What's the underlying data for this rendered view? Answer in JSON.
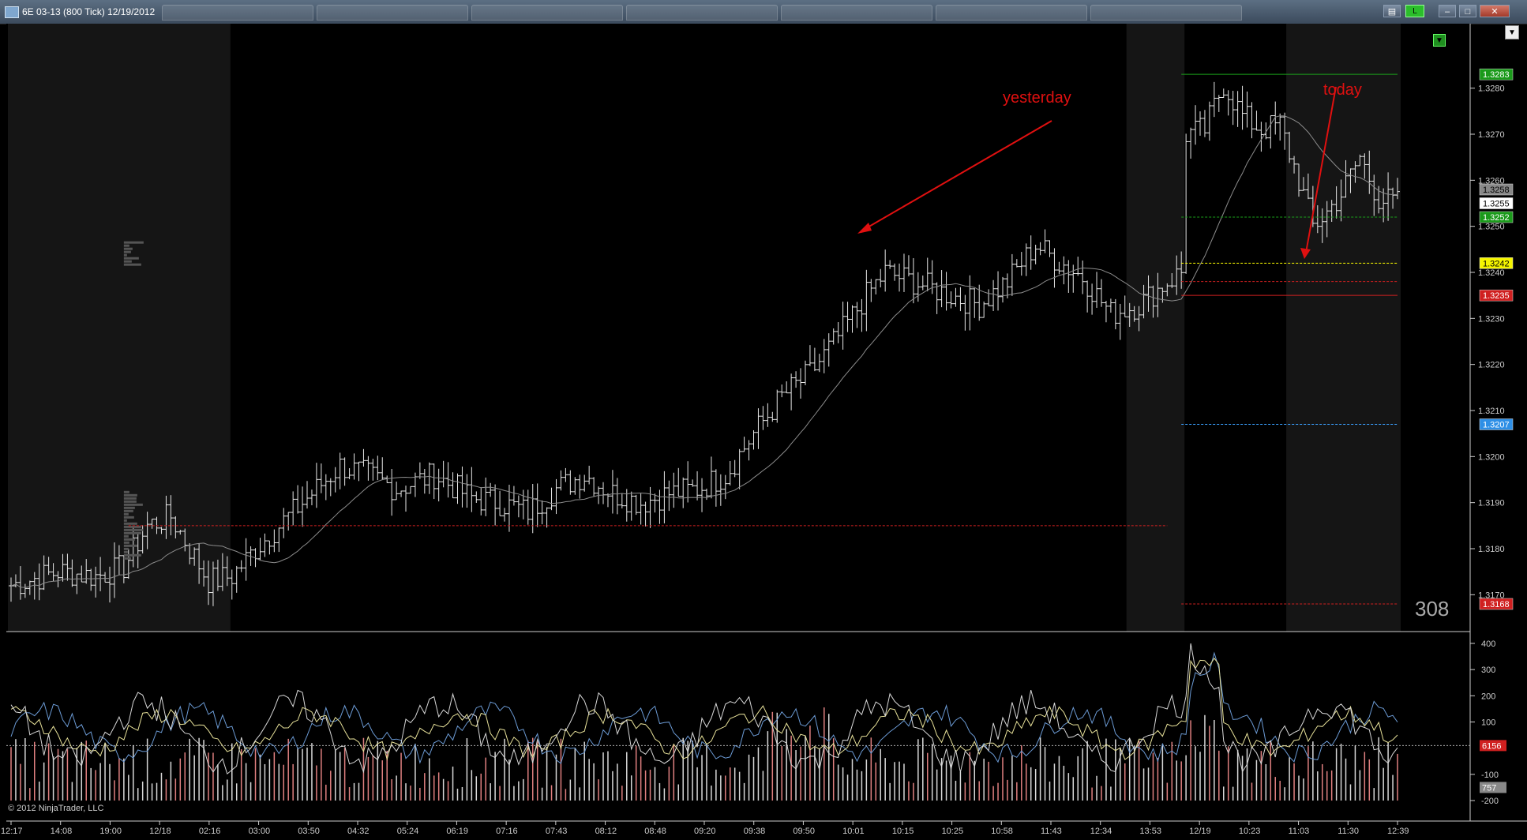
{
  "window": {
    "title": "6E 03-13 (800 Tick)  12/19/2012",
    "live_label": "L",
    "minimize_label": "–",
    "maximize_label": "□",
    "close_label": "✕",
    "tabs_count_note": ""
  },
  "annotations": {
    "yesterday": "yesterday",
    "today": "today"
  },
  "footer": {
    "copyright": "© 2012 NinjaTrader, LLC",
    "tick_count": "308"
  },
  "colors": {
    "background": "#000000",
    "session_shade": "#151515",
    "bars": "#e8e8e8",
    "annotation": "#e01010",
    "sma": "#8c8c8c",
    "level_green": "#1aa01a",
    "level_yellow": "#ffff00",
    "level_red": "#d02020",
    "level_blue": "#3aa0ff",
    "indicator_yellow": "#e8e29a",
    "indicator_blue": "#6b9ad4",
    "vol_up": "#e08080",
    "vol_down": "#d8d8d8"
  },
  "chart_data": {
    "type": "ohlc",
    "instrument": "6E 03-13",
    "interval": "800 Tick",
    "price_axis": {
      "ylim": [
        1.3162,
        1.3294
      ],
      "ticks": [
        "1.3170",
        "1.3180",
        "1.3190",
        "1.3200",
        "1.3210",
        "1.3220",
        "1.3230",
        "1.3240",
        "1.3250",
        "1.3260",
        "1.3270",
        "1.3280"
      ]
    },
    "price_labels": [
      {
        "value": 1.3283,
        "text": "1.3283",
        "style": "green"
      },
      {
        "value": 1.3258,
        "text": "1.3258",
        "style": "gray"
      },
      {
        "value": 1.3255,
        "text": "1.3255",
        "style": "white"
      },
      {
        "value": 1.3252,
        "text": "1.3252",
        "style": "green"
      },
      {
        "value": 1.3242,
        "text": "1.3242",
        "style": "yellow"
      },
      {
        "value": 1.3235,
        "text": "1.3235",
        "style": "red"
      },
      {
        "value": 1.3207,
        "text": "1.3207",
        "style": "blue"
      },
      {
        "value": 1.3168,
        "text": "1.3168",
        "style": "red"
      }
    ],
    "time_axis": [
      "12:17",
      "14:08",
      "19:00",
      "12/18",
      "02:16",
      "03:00",
      "03:50",
      "04:32",
      "05:24",
      "06:19",
      "07:16",
      "07:43",
      "08:12",
      "08:48",
      "09:20",
      "09:38",
      "09:50",
      "10:01",
      "10:15",
      "10:25",
      "10:58",
      "11:43",
      "12:34",
      "13:53",
      "12/19",
      "10:23",
      "11:03",
      "11:30",
      "12:39"
    ],
    "indicator_axis": {
      "ylim": [
        -230,
        430
      ],
      "ticks": [
        "400",
        "300",
        "200",
        "100",
        "-100",
        "-200"
      ],
      "labels": [
        {
          "value": 10,
          "text": "6156"
        },
        {
          "value": -150,
          "text": "757"
        }
      ]
    },
    "levels": [
      {
        "price": 1.3283,
        "color": "green",
        "from_bar": 249,
        "to_bar": 295,
        "dashed": false
      },
      {
        "price": 1.3252,
        "color": "green",
        "from_bar": 249,
        "to_bar": 295,
        "dashed": true
      },
      {
        "price": 1.3242,
        "color": "yellow",
        "from_bar": 249,
        "to_bar": 295,
        "dashed": true
      },
      {
        "price": 1.3238,
        "color": "red",
        "from_bar": 249,
        "to_bar": 295,
        "dashed": true
      },
      {
        "price": 1.3235,
        "color": "red",
        "from_bar": 249,
        "to_bar": 295,
        "dashed": false
      },
      {
        "price": 1.3207,
        "color": "blue",
        "from_bar": 249,
        "to_bar": 295,
        "dashed": true
      },
      {
        "price": 1.3168,
        "color": "red",
        "from_bar": 249,
        "to_bar": 295,
        "dashed": true
      },
      {
        "price": 1.3185,
        "color": "red",
        "from_bar": 25,
        "to_bar": 246,
        "dashed": true
      }
    ],
    "anchors": [
      [
        0,
        1.3172
      ],
      [
        10,
        1.3175
      ],
      [
        18,
        1.3174
      ],
      [
        24,
        1.3176
      ],
      [
        29,
        1.3185
      ],
      [
        34,
        1.3187
      ],
      [
        38,
        1.318
      ],
      [
        42,
        1.3173
      ],
      [
        47,
        1.3174
      ],
      [
        52,
        1.318
      ],
      [
        58,
        1.3186
      ],
      [
        64,
        1.3192
      ],
      [
        70,
        1.3198
      ],
      [
        76,
        1.3196
      ],
      [
        82,
        1.3193
      ],
      [
        90,
        1.3196
      ],
      [
        98,
        1.3191
      ],
      [
        104,
        1.319
      ],
      [
        110,
        1.3188
      ],
      [
        116,
        1.3193
      ],
      [
        122,
        1.3196
      ],
      [
        128,
        1.3192
      ],
      [
        134,
        1.319
      ],
      [
        140,
        1.3192
      ],
      [
        146,
        1.3193
      ],
      [
        152,
        1.3196
      ],
      [
        158,
        1.3205
      ],
      [
        164,
        1.3213
      ],
      [
        170,
        1.3218
      ],
      [
        176,
        1.3226
      ],
      [
        182,
        1.3235
      ],
      [
        186,
        1.324
      ],
      [
        192,
        1.3238
      ],
      [
        200,
        1.3235
      ],
      [
        206,
        1.3233
      ],
      [
        212,
        1.3238
      ],
      [
        218,
        1.3246
      ],
      [
        222,
        1.3243
      ],
      [
        228,
        1.3239
      ],
      [
        234,
        1.3231
      ],
      [
        240,
        1.3233
      ],
      [
        246,
        1.3238
      ],
      [
        249,
        1.324
      ],
      [
        250,
        1.327
      ],
      [
        254,
        1.3271
      ],
      [
        258,
        1.3281
      ],
      [
        262,
        1.3274
      ],
      [
        266,
        1.3271
      ],
      [
        270,
        1.3272
      ],
      [
        274,
        1.326
      ],
      [
        277,
        1.325
      ],
      [
        280,
        1.3253
      ],
      [
        283,
        1.3257
      ],
      [
        287,
        1.3265
      ],
      [
        291,
        1.3256
      ],
      [
        295,
        1.3255
      ]
    ],
    "total_bars": 296,
    "sessions_shaded": [
      [
        0,
        46
      ],
      [
        238,
        249
      ],
      [
        272,
        295
      ]
    ]
  }
}
